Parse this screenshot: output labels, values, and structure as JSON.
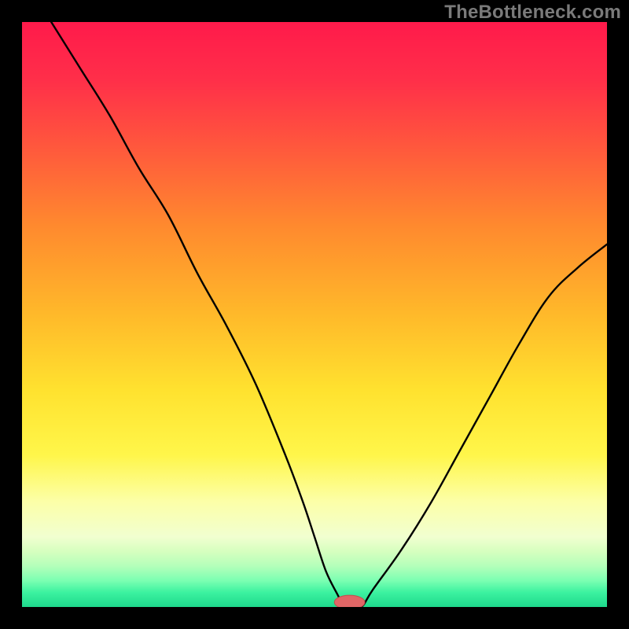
{
  "watermark": "TheBottleneck.com",
  "colors": {
    "frame": "#000000",
    "curve": "#000000",
    "marker_fill": "#e06666",
    "marker_stroke": "#c44d4d",
    "gradient_stops": [
      {
        "offset": 0.0,
        "color": "#ff1a4b"
      },
      {
        "offset": 0.1,
        "color": "#ff2f49"
      },
      {
        "offset": 0.22,
        "color": "#ff5a3c"
      },
      {
        "offset": 0.35,
        "color": "#ff8a2e"
      },
      {
        "offset": 0.5,
        "color": "#ffb92a"
      },
      {
        "offset": 0.63,
        "color": "#ffe22f"
      },
      {
        "offset": 0.74,
        "color": "#fff64a"
      },
      {
        "offset": 0.82,
        "color": "#fcffa8"
      },
      {
        "offset": 0.88,
        "color": "#f1ffd0"
      },
      {
        "offset": 0.905,
        "color": "#d6ffbf"
      },
      {
        "offset": 0.93,
        "color": "#b4ffba"
      },
      {
        "offset": 0.955,
        "color": "#7bffb2"
      },
      {
        "offset": 0.975,
        "color": "#3cf2a0"
      },
      {
        "offset": 1.0,
        "color": "#1ed98c"
      }
    ]
  },
  "chart_data": {
    "type": "line",
    "title": "",
    "xlabel": "",
    "ylabel": "",
    "xlim": [
      0,
      100
    ],
    "ylim": [
      0,
      100
    ],
    "x": [
      5,
      10,
      15,
      20,
      25,
      30,
      35,
      40,
      45,
      48,
      50,
      52,
      54,
      55,
      56,
      58,
      60,
      65,
      70,
      75,
      80,
      85,
      90,
      95,
      100
    ],
    "values": [
      100,
      92,
      84,
      75,
      67,
      57,
      48,
      38,
      26,
      18,
      12,
      6,
      2,
      0,
      0,
      0,
      3,
      10,
      18,
      27,
      36,
      45,
      53,
      58,
      62
    ],
    "marker": {
      "x": 56,
      "y": 0,
      "rx": 2.6,
      "ry": 1.2
    }
  }
}
